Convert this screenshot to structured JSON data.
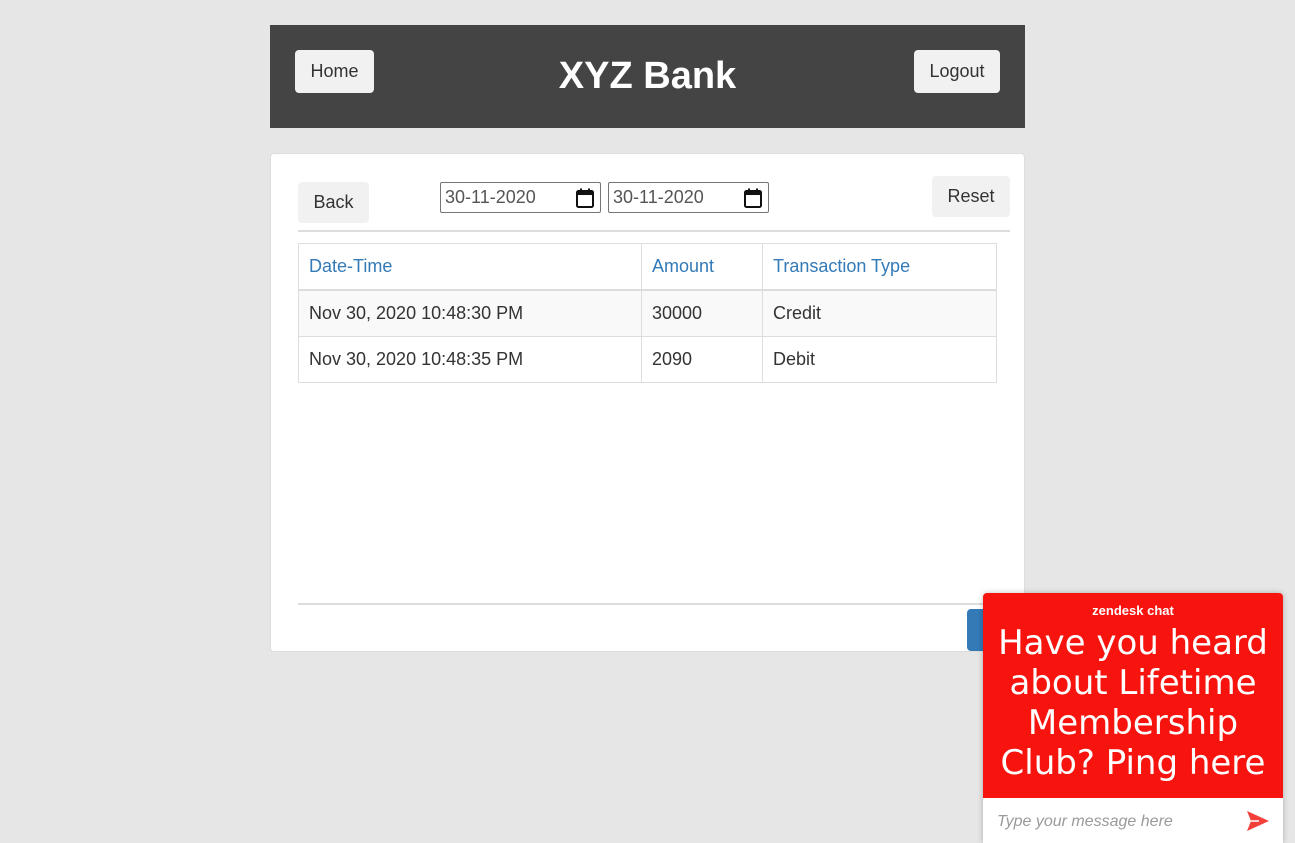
{
  "header": {
    "title": "XYZ Bank",
    "home_label": "Home",
    "logout_label": "Logout"
  },
  "toolbar": {
    "back_label": "Back",
    "reset_label": "Reset",
    "date_from": "30-11-2020",
    "date_to": "30-11-2020"
  },
  "table": {
    "columns": [
      "Date-Time",
      "Amount",
      "Transaction Type"
    ],
    "rows": [
      {
        "datetime": "Nov 30, 2020 10:48:30 PM",
        "amount": "30000",
        "type": "Credit"
      },
      {
        "datetime": "Nov 30, 2020 10:48:35 PM",
        "amount": "2090",
        "type": "Debit"
      }
    ]
  },
  "chat": {
    "brand": "zendesk chat",
    "message": "Have you heard about Lifetime Membership Club? Ping here",
    "placeholder": "Type your message here",
    "send_icon": "send-icon"
  },
  "colors": {
    "header_bg": "#444444",
    "link_blue": "#337ab7",
    "chat_red": "#f7140f"
  }
}
